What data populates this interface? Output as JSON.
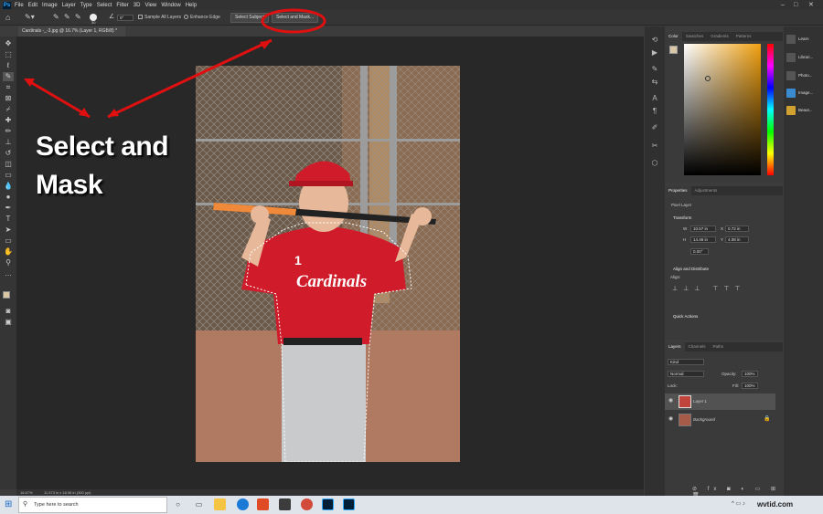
{
  "menubar": {
    "app_icon": "Ps",
    "items": [
      "File",
      "Edit",
      "Image",
      "Layer",
      "Type",
      "Select",
      "Filter",
      "3D",
      "View",
      "Window",
      "Help"
    ]
  },
  "options": {
    "size_value": "30",
    "angle_value": "0°",
    "sample_all_layers": "Sample All Layers",
    "enhance_edge": "Enhance Edge",
    "select_subject": "Select Subject",
    "select_and_mask": "Select and Mask..."
  },
  "document": {
    "tab_title": "Cardinals -_-3.jpg @ 16.7% (Layer 1, RGB/8) *",
    "zoom": "16.67%",
    "doc_size": "11.573 in x 18.96 in (300 ppi)"
  },
  "annotation": {
    "line1": "Select and",
    "line2": "Mask",
    "color": "#e01010"
  },
  "photo": {
    "jersey_text": "Cardinals",
    "jersey_number": "1"
  },
  "color_panel": {
    "tabs": [
      "Color",
      "Swatches",
      "Gradients",
      "Patterns"
    ],
    "hue": "#f0a010"
  },
  "properties": {
    "tabs": [
      "Properties",
      "Adjustments"
    ],
    "layer_type": "Pixel Layer",
    "transform_title": "Transform",
    "w": "10.57 in",
    "x": "0.72 in",
    "h": "14.46 in",
    "y": "4.08 in",
    "angle": "0.00°",
    "align_title": "Align and Distribute",
    "align_label": "Align:",
    "quick_actions": "Quick Actions"
  },
  "layers": {
    "tabs": [
      "Layers",
      "Channels",
      "Paths"
    ],
    "kind": "Kind",
    "blend": "Normal",
    "opacity_label": "Opacity:",
    "opacity": "100%",
    "lock_label": "Lock:",
    "fill_label": "Fill:",
    "fill": "100%",
    "items": [
      "Layer 1",
      "Background"
    ]
  },
  "learn": {
    "items": [
      "Learn",
      "Librari...",
      "Photo...",
      "Image...",
      "Beaut..."
    ]
  },
  "taskbar": {
    "search": "Type here to search",
    "tray": "wvtid.com"
  }
}
